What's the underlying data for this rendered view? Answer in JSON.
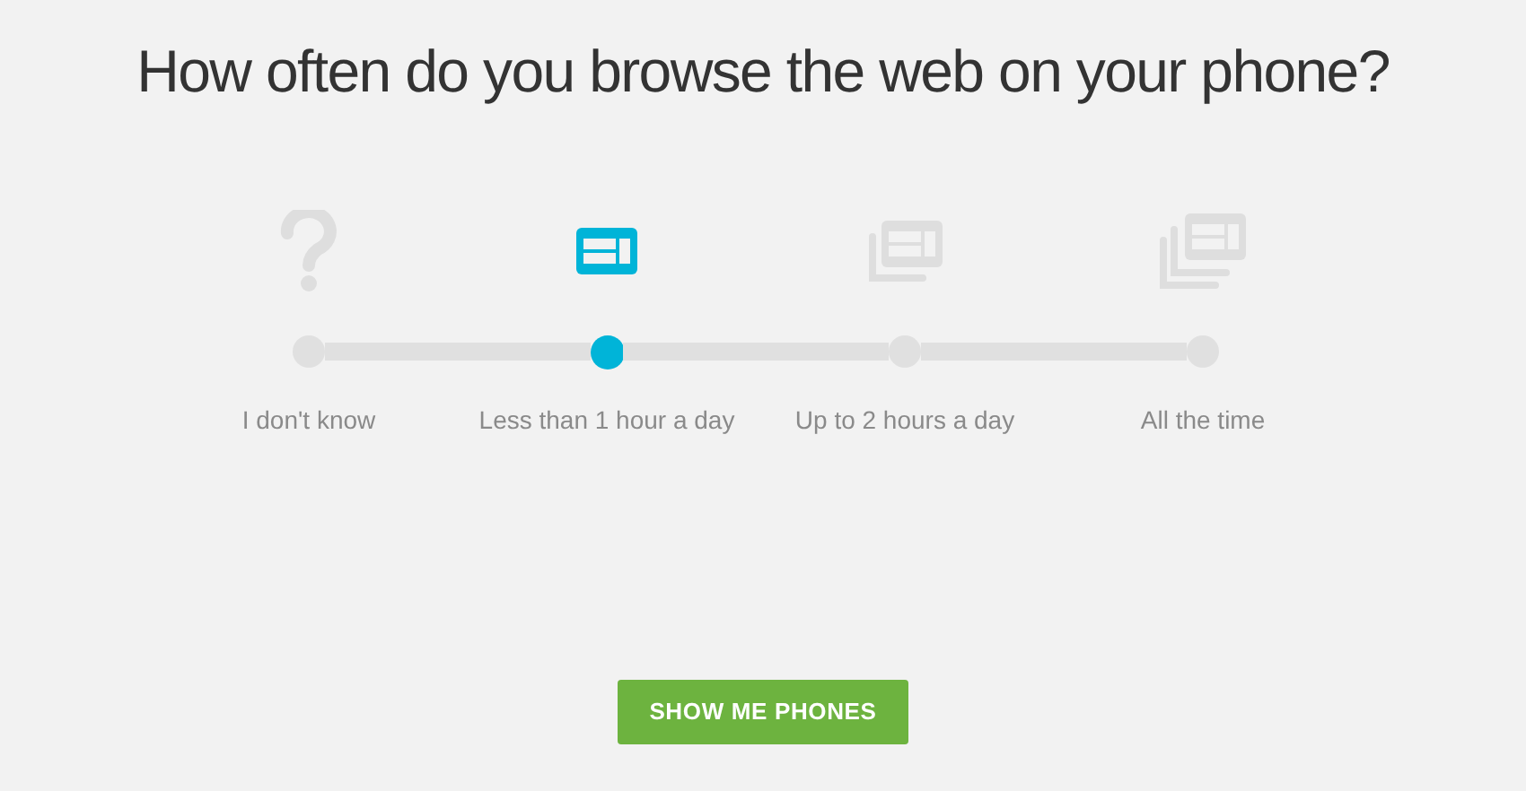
{
  "question": "How often do you browse the web on your phone?",
  "options": [
    {
      "kind": "unknown",
      "label": "I don't know",
      "selected": false
    },
    {
      "kind": "single",
      "label": "Less than 1 hour a day",
      "selected": true
    },
    {
      "kind": "double",
      "label": "Up to 2 hours a day",
      "selected": false
    },
    {
      "kind": "triple",
      "label": "All the time",
      "selected": false
    }
  ],
  "button": "SHOW ME PHONES"
}
